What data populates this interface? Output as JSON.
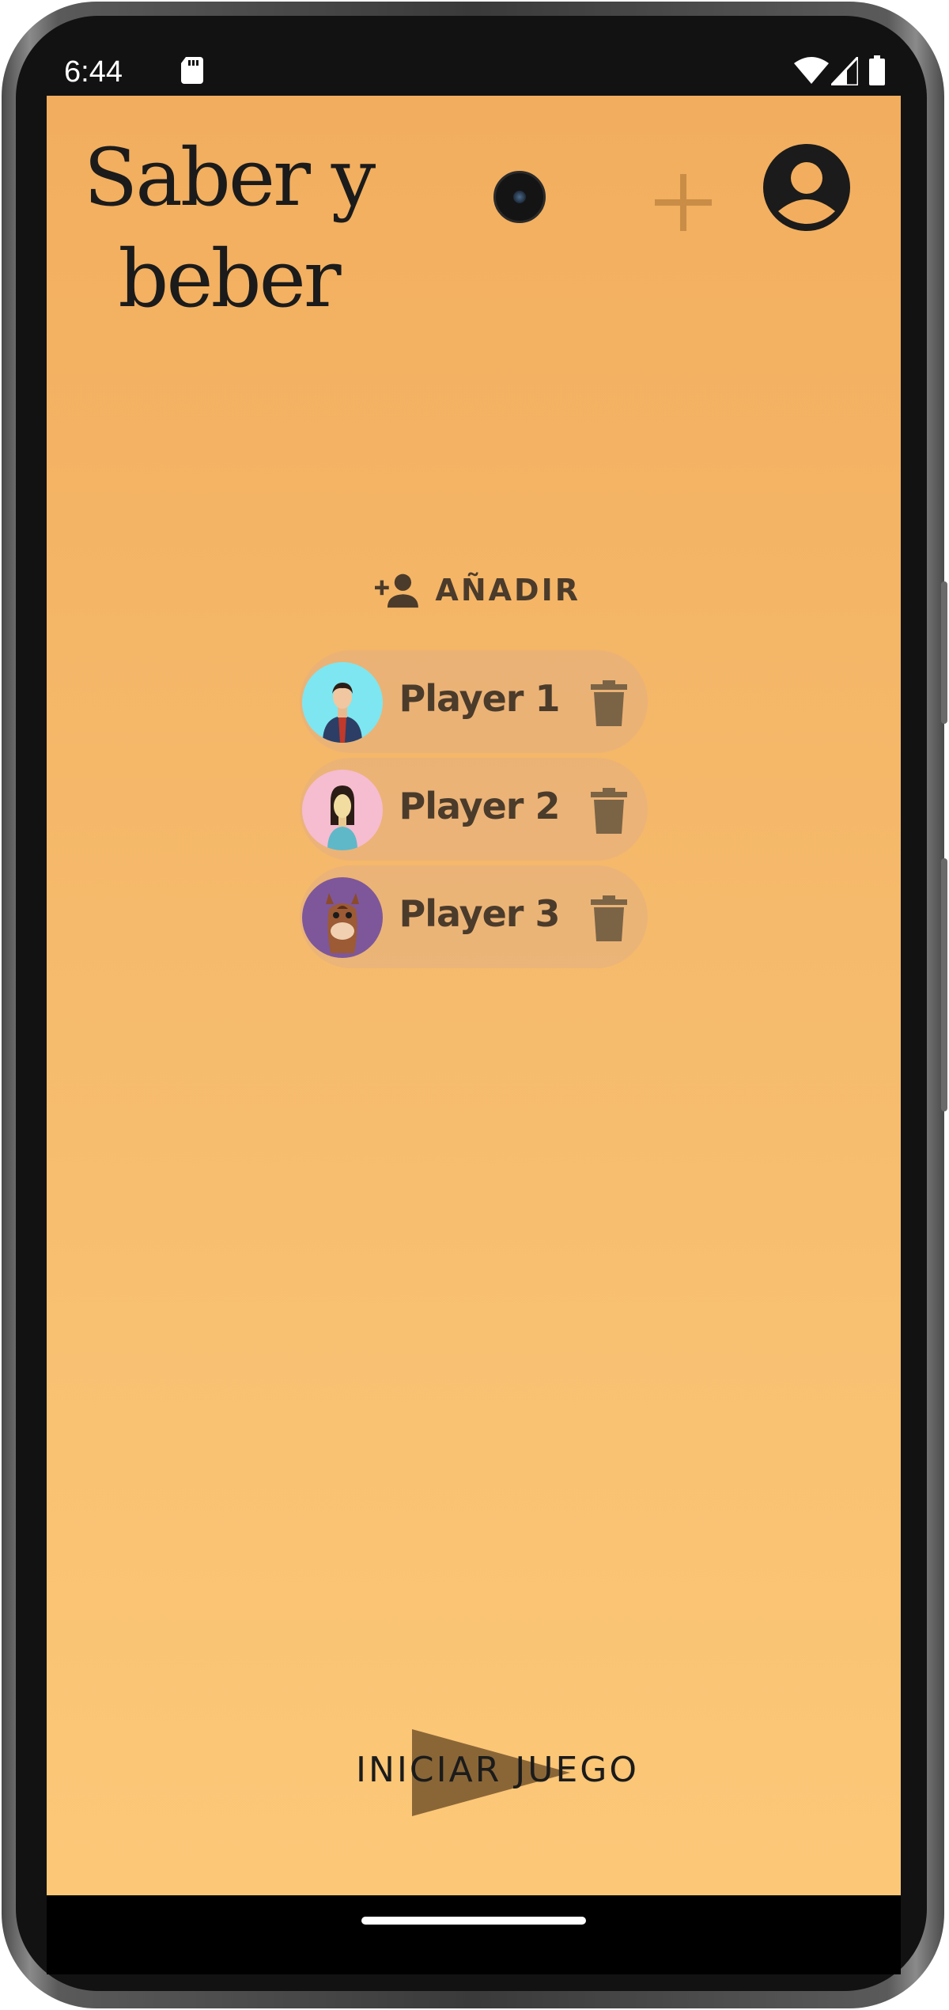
{
  "status_bar": {
    "time": "6:44",
    "icons": [
      "sd-card-icon",
      "wifi-icon",
      "cell-signal-icon",
      "battery-icon"
    ]
  },
  "app": {
    "title": "Saber y beber",
    "title_line1": "Saber y",
    "title_line2": "beber",
    "icons": {
      "add_game": "plus-icon",
      "profile": "account-circle-icon"
    }
  },
  "add_player": {
    "label": "AÑADIR",
    "icon": "person-add-icon"
  },
  "players": [
    {
      "name": "Player 1",
      "avatar": "man-avatar",
      "avatar_bg": "#7ee6f0"
    },
    {
      "name": "Player 2",
      "avatar": "woman-avatar",
      "avatar_bg": "#f6bcd0"
    },
    {
      "name": "Player 3",
      "avatar": "horse-avatar",
      "avatar_bg": "#7e579a"
    }
  ],
  "start_button": {
    "label": "INICIAR JUEGO",
    "icon": "play-icon"
  },
  "colors": {
    "background_top": "#f2ae5e",
    "background_bottom": "#fcc878",
    "chip_text": "#4b3b2b",
    "plus_accent": "#c98d47"
  }
}
